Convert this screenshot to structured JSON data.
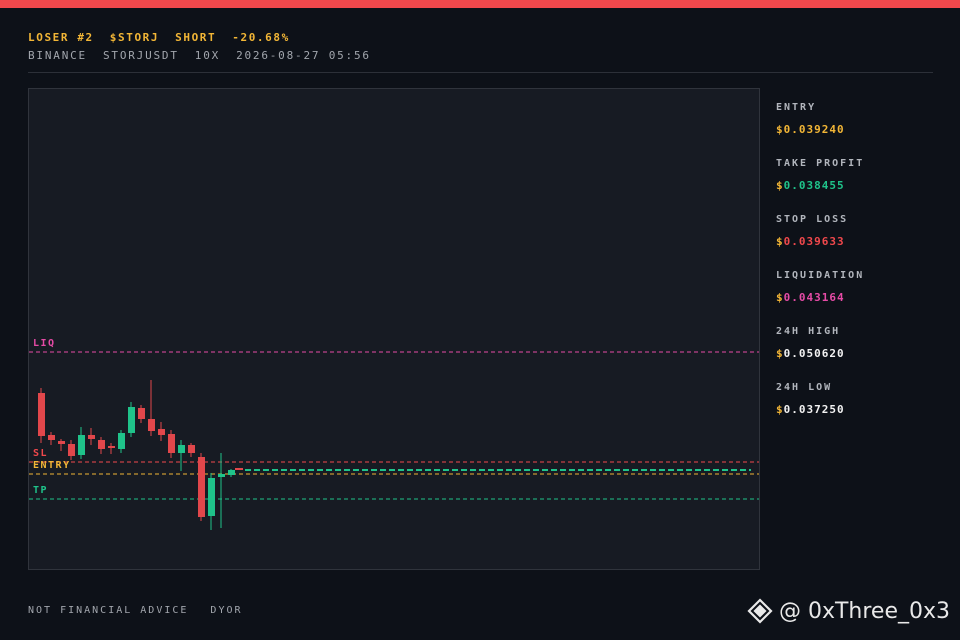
{
  "header": {
    "rank": "LOSER #2",
    "ticker": "$STORJ",
    "side": "SHORT",
    "change": "-20.68%",
    "exchange": "BINANCE",
    "pair": "STORJUSDT",
    "leverage": "10X",
    "datetime": "2026-08-27 05:56"
  },
  "chart_labels": {
    "liq": "LIQ",
    "sl": "SL",
    "entry": "ENTRY",
    "tp": "TP"
  },
  "stats": [
    {
      "key": "ENTRY",
      "currency": "$",
      "value": "0.039240",
      "color": "#f2b636"
    },
    {
      "key": "TAKE PROFIT",
      "currency": "$",
      "value": "0.038455",
      "color": "#1fc38a"
    },
    {
      "key": "STOP LOSS",
      "currency": "$",
      "value": "0.039633",
      "color": "#f0484c"
    },
    {
      "key": "LIQUIDATION",
      "currency": "$",
      "value": "0.043164",
      "color": "#e64ba6"
    },
    {
      "key": "24H HIGH",
      "currency": "$",
      "value": "0.050620",
      "color": "#f2f2f2"
    },
    {
      "key": "24H LOW",
      "currency": "$",
      "value": "0.037250",
      "color": "#f2f2f2"
    }
  ],
  "footer": {
    "disclaimer": "NOT FINANCIAL ADVICE",
    "dyor": "DYOR"
  },
  "watermark": {
    "handle": "@ 0xThree_0x3",
    "icon": "binance-logo-icon"
  },
  "colors": {
    "up": "#1fc38a",
    "down": "#e2474b",
    "liq": "#e64ba6",
    "sl": "#f0484c",
    "entry": "#f2b636",
    "tp": "#1fc38a",
    "accent_bar": "#f0484c"
  }
}
